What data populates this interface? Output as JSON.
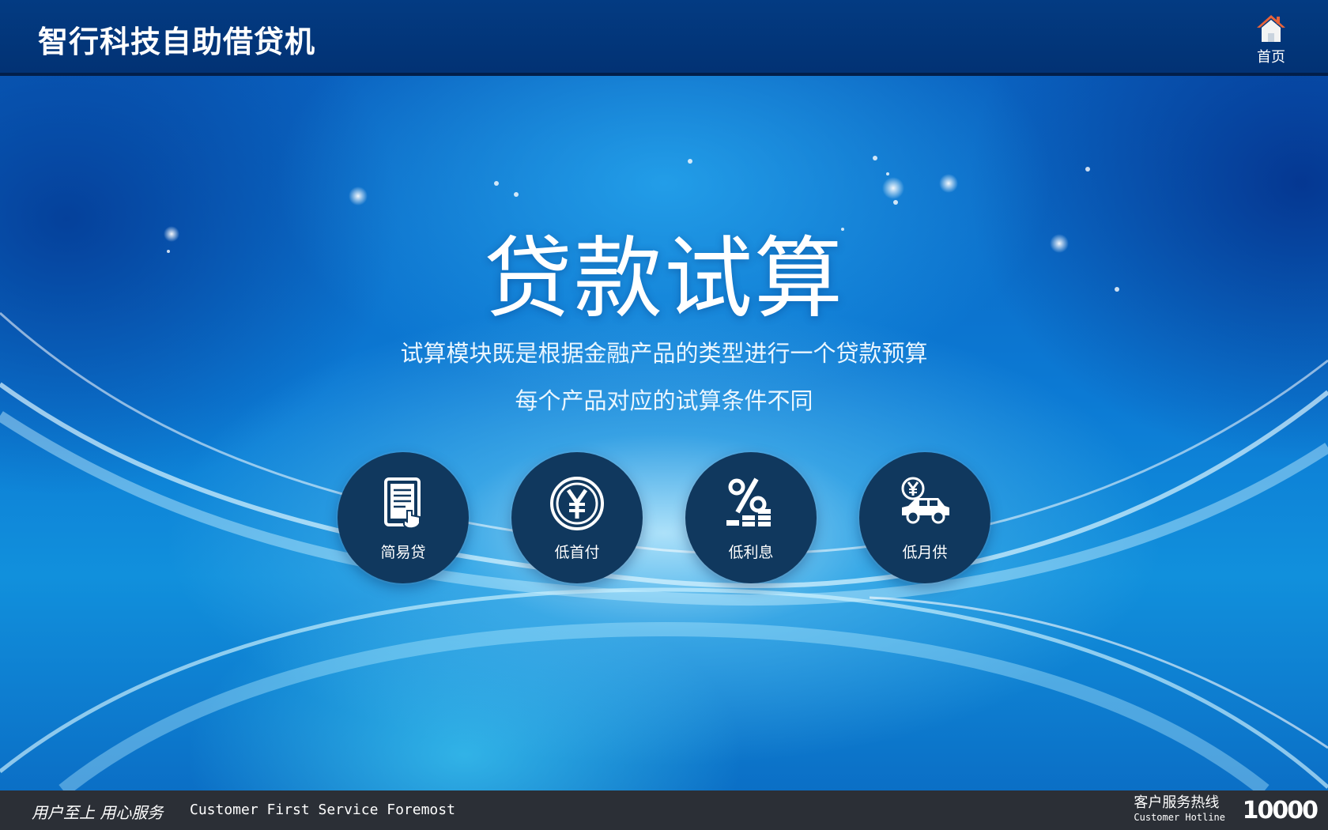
{
  "header": {
    "app_title": "智行科技自助借贷机",
    "home_label": "首页",
    "home_icon": "home-icon"
  },
  "main": {
    "title": "贷款试算",
    "description_line1": "试算模块既是根据金融产品的类型进行一个贷款预算",
    "description_line2": "每个产品对应的试算条件不同"
  },
  "features": [
    {
      "label": "简易贷",
      "icon": "tablet-touch-icon"
    },
    {
      "label": "低首付",
      "icon": "yen-coin-icon"
    },
    {
      "label": "低利息",
      "icon": "percent-coins-icon"
    },
    {
      "label": "低月供",
      "icon": "car-yen-icon"
    }
  ],
  "footer": {
    "slogan_cn": "用户至上  用心服务",
    "slogan_en": "Customer First Service Foremost",
    "hotline_cn": "客户服务热线",
    "hotline_en": "Customer Hotline",
    "hotline_number": "10000"
  },
  "colors": {
    "header_bg": "#023274",
    "feature_circle": "#10385e",
    "footer_bg": "#2b2f36",
    "home_icon_roof": "#e8633a"
  }
}
